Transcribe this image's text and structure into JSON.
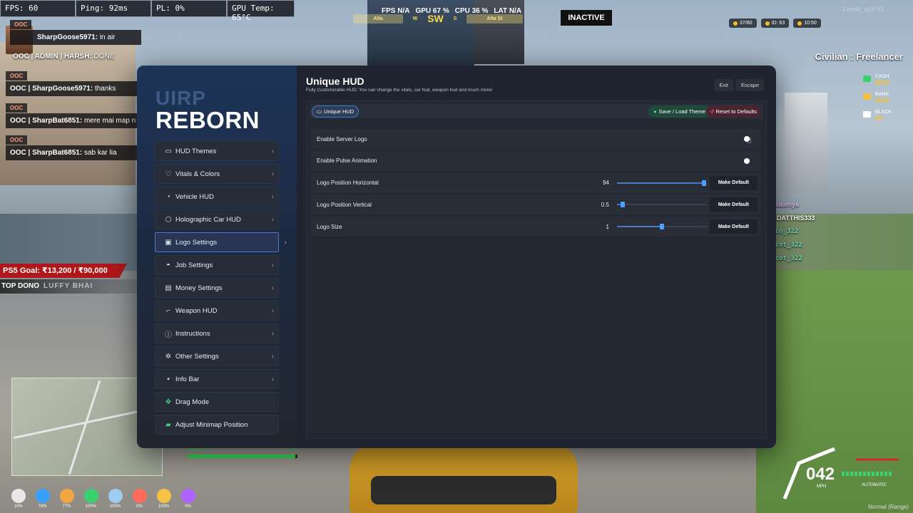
{
  "perf": {
    "fps": "FPS: 60",
    "ping": "Ping: 92ms",
    "pl": "PL: 0%",
    "gpu_temp": "GPU Temp: 65°C"
  },
  "net_stats": {
    "fps_lbl": "FPS",
    "fps_val": "N/A",
    "gpu_lbl": "GPU",
    "gpu_val": "67 %",
    "cpu_lbl": "CPU",
    "cpu_val": "36 %",
    "lat_lbl": "LAT",
    "lat_val": "N/A"
  },
  "compass": {
    "left_street": "Alta",
    "west": "W",
    "heading": "SW",
    "south": "S",
    "right_street": "Alta St"
  },
  "status_badge": "INACTIVE",
  "player_info": {
    "players": "37/80",
    "id": "ID: 63",
    "time": "10:50"
  },
  "watermark": "FiveM_rp3751",
  "job": "Civilian : Freelancer",
  "money": [
    {
      "label": "CASH",
      "value": "$500",
      "color": "#3bd16f"
    },
    {
      "label": "BANK",
      "value": "$500",
      "color": "#f5c142"
    },
    {
      "label": "BLACK",
      "value": "$0",
      "color": "#ffffff"
    }
  ],
  "chat": [
    {
      "tag": "OOC",
      "who": "SharpGoose5971:",
      "text": " in air"
    },
    {
      "tag": "",
      "who": "OOC | ADMIN | HARSH:",
      "text": " DONE"
    },
    {
      "tag": "OOC",
      "who": "OOC | SharpGoose5971:",
      "text": " thanks"
    },
    {
      "tag": "OOC",
      "who": "OOC | SharpBat6851:",
      "text": " mere mai map n"
    },
    {
      "tag": "OOC",
      "who": "OOC | SharpBat6851:",
      "text": " sab kar lia"
    }
  ],
  "goal": "PS5 Goal: ₹13,200 / ₹90,000",
  "dono": {
    "label": "TOP DONO",
    "name": "LUFFY BHAI"
  },
  "player_list": [
    {
      "name": "oksaumya",
      "style": "pink"
    },
    {
      "name": "BADATTHIS333",
      "style": "white"
    },
    {
      "name": "Asco_322",
      "style": "green"
    },
    {
      "name": "Ascot_322",
      "style": "green"
    },
    {
      "name": "Ascot_322",
      "style": "green"
    }
  ],
  "health": {
    "label": "HEALTH",
    "pct": "98%",
    "fill": 0.98
  },
  "vitals": [
    {
      "pct": "10%",
      "color": "#e8e8e8"
    },
    {
      "pct": "78%",
      "color": "#3aa0ff"
    },
    {
      "pct": "77%",
      "color": "#f5a442"
    },
    {
      "pct": "100%",
      "color": "#3bd16f"
    },
    {
      "pct": "100%",
      "color": "#9ecbf0"
    },
    {
      "pct": "0%",
      "color": "#ff6b5b"
    },
    {
      "pct": "100%",
      "color": "#f5c142"
    },
    {
      "pct": "0%",
      "color": "#b061ff"
    }
  ],
  "speed": {
    "value": "042",
    "unit": "MPH",
    "gear": "AUTOMATIC"
  },
  "bottom_right": "Normal (Range)",
  "menu": {
    "logo_top": "UIRP",
    "logo_main": "REBORN",
    "nav": [
      {
        "label": "HUD Themes",
        "icon": "monitor-icon",
        "glyph": "▭"
      },
      {
        "label": "Vitals & Colors",
        "icon": "heart-icon",
        "glyph": "♡"
      },
      {
        "label": "Vehicle HUD",
        "icon": "gauge-icon",
        "glyph": "◔"
      },
      {
        "label": "Holographic Car HUD",
        "icon": "cube-icon",
        "glyph": "⬡"
      },
      {
        "label": "Logo Settings",
        "icon": "image-icon",
        "glyph": "▣",
        "active": true
      },
      {
        "label": "Job Settings",
        "icon": "hardhat-icon",
        "glyph": "◓"
      },
      {
        "label": "Money Settings",
        "icon": "money-icon",
        "glyph": "▤"
      },
      {
        "label": "Weapon HUD",
        "icon": "gun-icon",
        "glyph": "⌐"
      },
      {
        "label": "Instructions",
        "icon": "info-icon",
        "glyph": "ⓘ"
      },
      {
        "label": "Other Settings",
        "icon": "cogs-icon",
        "glyph": "✲"
      },
      {
        "label": "Info Bar",
        "icon": "info-square-icon",
        "glyph": "▪"
      },
      {
        "label": "Drag Mode",
        "icon": "move-icon",
        "glyph": "✥",
        "special": true
      },
      {
        "label": "Adjust Minimap Position",
        "icon": "map-icon",
        "glyph": "▰",
        "special": true
      }
    ],
    "title": "Unique HUD",
    "subtitle": "Fully Customizable HUD: You can change the vitals, car hud, weapon hud and much more!",
    "exit": "Exit",
    "escape": "Escape",
    "tab": "Unique HUD",
    "save_load": "Save / Load Theme",
    "reset": "Reset to Defaults",
    "make_default": "Make Default",
    "rows": [
      {
        "label": "Enable Server Logo",
        "type": "toggle"
      },
      {
        "label": "Enable Pulse Animation",
        "type": "toggle"
      },
      {
        "label": "Logo Position Horizontal",
        "type": "slider",
        "value": "94",
        "fill": 0.97
      },
      {
        "label": "Logo Position Vertical",
        "type": "slider",
        "value": "0.5",
        "fill": 0.06
      },
      {
        "label": "Logo Size",
        "type": "slider",
        "value": "1",
        "fill": 0.5
      }
    ]
  }
}
